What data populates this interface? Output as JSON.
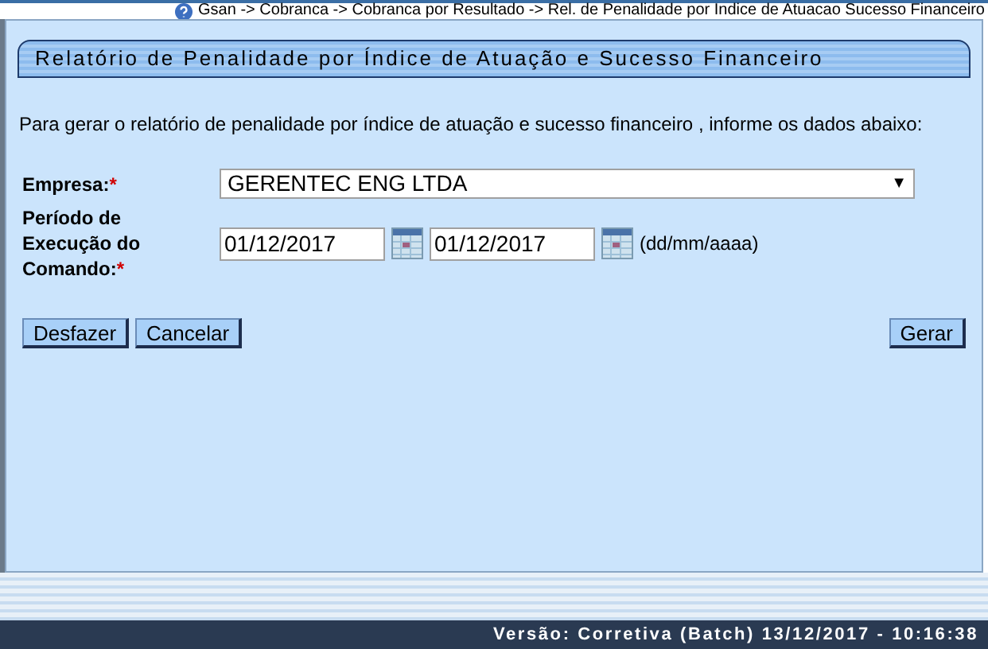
{
  "breadcrumb": "Gsan -> Cobranca -> Cobranca por Resultado -> Rel. de Penalidade por Indice de Atuacao Sucesso Financeiro",
  "title": "Relatório de Penalidade por Índice de Atuação e Sucesso Financeiro",
  "intro": "Para gerar o relatório de penalidade por índice de atuação e sucesso financeiro , informe os dados abaixo:",
  "empresa": {
    "label": "Empresa:",
    "required_mark": "*",
    "value": "GERENTEC ENG LTDA",
    "caret": "▼"
  },
  "periodo": {
    "label": "Período de Execução do Comando:",
    "required_mark": "*",
    "start": "01/12/2017",
    "end": "01/12/2017",
    "format_hint": "(dd/mm/aaaa)"
  },
  "buttons_left": [
    "Desfazer",
    "Cancelar"
  ],
  "button_right": "Gerar",
  "status_bar": "Versão: Corretiva (Batch) 13/12/2017 - 10:16:38"
}
